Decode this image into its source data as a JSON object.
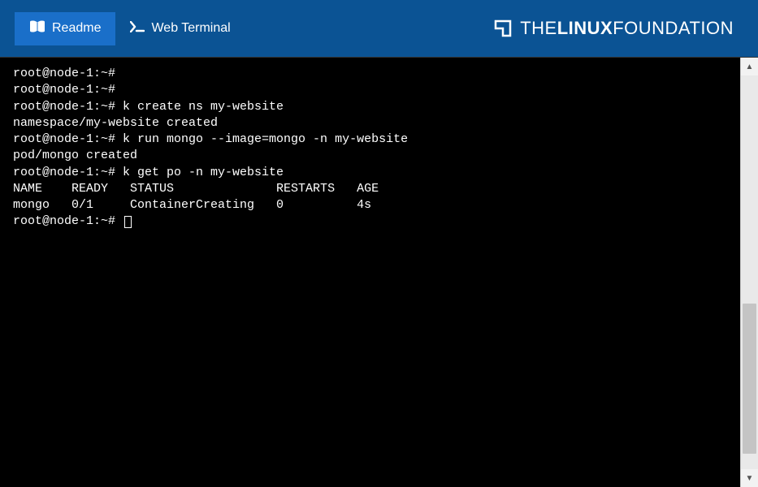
{
  "header": {
    "tabs": [
      {
        "label": "Readme",
        "icon": "book-icon",
        "active": true
      },
      {
        "label": "Web Terminal",
        "icon": "prompt-icon",
        "active": false
      }
    ],
    "brand": {
      "the": "THE",
      "linux": "LINUX",
      "foundation": "FOUNDATION"
    }
  },
  "terminal": {
    "lines": [
      "root@node-1:~#",
      "root@node-1:~#",
      "root@node-1:~# k create ns my-website",
      "namespace/my-website created",
      "root@node-1:~# k run mongo --image=mongo -n my-website",
      "pod/mongo created",
      "root@node-1:~# k get po -n my-website",
      "NAME    READY   STATUS              RESTARTS   AGE",
      "mongo   0/1     ContainerCreating   0          4s",
      "root@node-1:~# "
    ],
    "table": {
      "headers": [
        "NAME",
        "READY",
        "STATUS",
        "RESTARTS",
        "AGE"
      ],
      "rows": [
        {
          "NAME": "mongo",
          "READY": "0/1",
          "STATUS": "ContainerCreating",
          "RESTARTS": "0",
          "AGE": "4s"
        }
      ]
    }
  }
}
